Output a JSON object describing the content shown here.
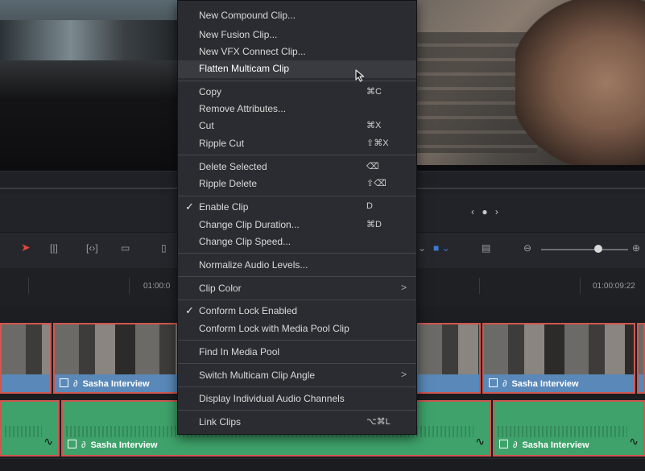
{
  "menu": {
    "items": [
      {
        "label": "New Compound Clip...",
        "shortcut": "",
        "check": "",
        "submenu": ""
      },
      {
        "label": "New Fusion Clip...",
        "shortcut": "",
        "check": "",
        "submenu": ""
      },
      {
        "label": "New VFX Connect Clip...",
        "shortcut": "",
        "check": "",
        "submenu": ""
      },
      {
        "label": "Flatten Multicam Clip",
        "shortcut": "",
        "check": "",
        "submenu": ""
      },
      {
        "label": "Copy",
        "shortcut": "⌘C",
        "check": "",
        "submenu": ""
      },
      {
        "label": "Remove Attributes...",
        "shortcut": "",
        "check": "",
        "submenu": ""
      },
      {
        "label": "Cut",
        "shortcut": "⌘X",
        "check": "",
        "submenu": ""
      },
      {
        "label": "Ripple Cut",
        "shortcut": "⇧⌘X",
        "check": "",
        "submenu": ""
      },
      {
        "label": "Delete Selected",
        "shortcut": "⌫",
        "check": "",
        "submenu": ""
      },
      {
        "label": "Ripple Delete",
        "shortcut": "⇧⌫",
        "check": "",
        "submenu": ""
      },
      {
        "label": "Enable Clip",
        "shortcut": "D",
        "check": "✓",
        "submenu": ""
      },
      {
        "label": "Change Clip Duration...",
        "shortcut": "⌘D",
        "check": "",
        "submenu": ""
      },
      {
        "label": "Change Clip Speed...",
        "shortcut": "",
        "check": "",
        "submenu": ""
      },
      {
        "label": "Normalize Audio Levels...",
        "shortcut": "",
        "check": "",
        "submenu": ""
      },
      {
        "label": "Clip Color",
        "shortcut": "",
        "check": "",
        "submenu": ">"
      },
      {
        "label": "Conform Lock Enabled",
        "shortcut": "",
        "check": "✓",
        "submenu": ""
      },
      {
        "label": "Conform Lock with Media Pool Clip",
        "shortcut": "",
        "check": "",
        "submenu": ""
      },
      {
        "label": "Find In Media Pool",
        "shortcut": "",
        "check": "",
        "submenu": ""
      },
      {
        "label": "Switch Multicam Clip Angle",
        "shortcut": "",
        "check": "",
        "submenu": ">"
      },
      {
        "label": "Display Individual Audio Channels",
        "shortcut": "",
        "check": "",
        "submenu": ""
      },
      {
        "label": "Link Clips",
        "shortcut": "⌥⌘L",
        "check": "",
        "submenu": ""
      }
    ]
  },
  "timeline": {
    "timecode_1": "01:00:0",
    "timecode_2": "01:00:09:22",
    "clip_name": "Sasha Interview",
    "nav_arrows": "‹ ● ›"
  },
  "colors": {
    "video_clip": "#5a88b8",
    "audio_clip": "#3ea26a",
    "selection_border": "#d0564f",
    "menu_bg": "#2b2c31"
  }
}
